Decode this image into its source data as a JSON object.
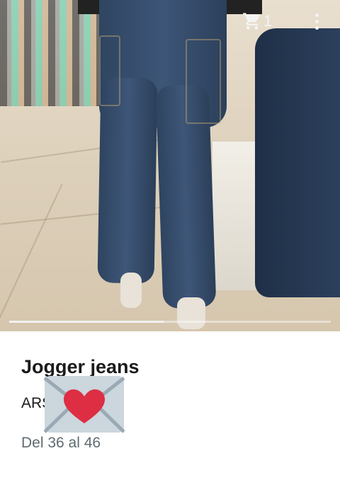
{
  "header": {
    "cart_icon": "shopping-cart-icon",
    "cart_count": "1",
    "menu_icon": "more-vert-icon"
  },
  "gallery": {
    "progress": 0.48,
    "progress_color": "#f2f2f2"
  },
  "product": {
    "title": "Jogger jeans",
    "price": "ARS",
    "sizes": "Del 36 al 46"
  },
  "overlay": {
    "icon": "love-letter-icon"
  }
}
